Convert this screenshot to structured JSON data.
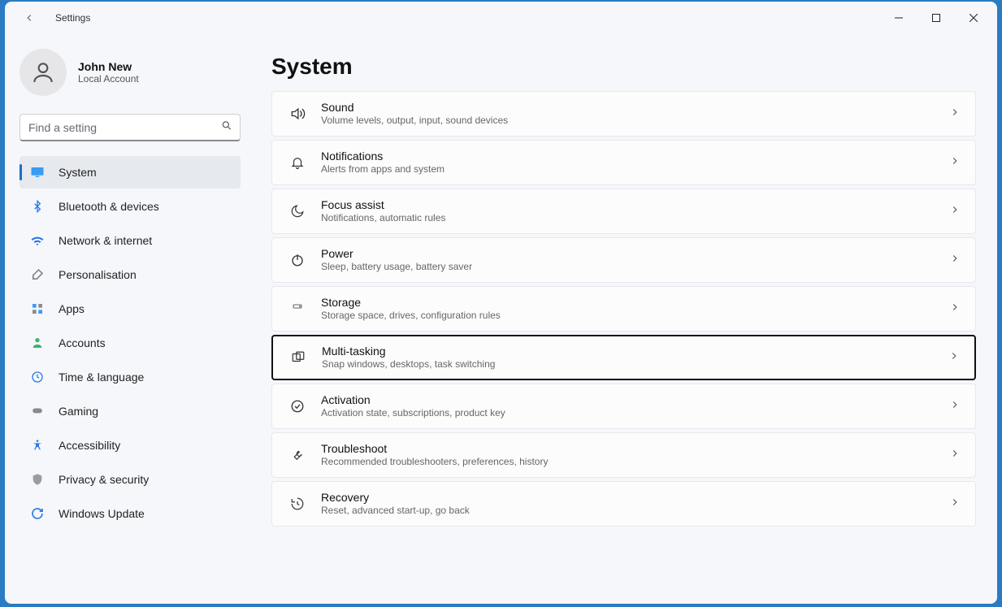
{
  "window": {
    "title": "Settings"
  },
  "user": {
    "name": "John New",
    "subtitle": "Local Account"
  },
  "search": {
    "placeholder": "Find a setting"
  },
  "nav": [
    {
      "id": "system",
      "label": "System",
      "icon": "monitor",
      "active": true
    },
    {
      "id": "bluetooth",
      "label": "Bluetooth & devices",
      "icon": "bluetooth",
      "active": false
    },
    {
      "id": "network",
      "label": "Network & internet",
      "icon": "wifi",
      "active": false
    },
    {
      "id": "personal",
      "label": "Personalisation",
      "icon": "brush",
      "active": false
    },
    {
      "id": "apps",
      "label": "Apps",
      "icon": "grid",
      "active": false
    },
    {
      "id": "accounts",
      "label": "Accounts",
      "icon": "person",
      "active": false
    },
    {
      "id": "time",
      "label": "Time & language",
      "icon": "clock",
      "active": false
    },
    {
      "id": "gaming",
      "label": "Gaming",
      "icon": "gamepad",
      "active": false
    },
    {
      "id": "accessibility",
      "label": "Accessibility",
      "icon": "accessibility",
      "active": false
    },
    {
      "id": "privacy",
      "label": "Privacy & security",
      "icon": "shield",
      "active": false
    },
    {
      "id": "update",
      "label": "Windows Update",
      "icon": "update",
      "active": false
    }
  ],
  "page": {
    "title": "System",
    "items": [
      {
        "id": "sound",
        "title": "Sound",
        "desc": "Volume levels, output, input, sound devices",
        "icon": "sound",
        "focused": false
      },
      {
        "id": "notifications",
        "title": "Notifications",
        "desc": "Alerts from apps and system",
        "icon": "bell",
        "focused": false
      },
      {
        "id": "focus",
        "title": "Focus assist",
        "desc": "Notifications, automatic rules",
        "icon": "moon",
        "focused": false
      },
      {
        "id": "power",
        "title": "Power",
        "desc": "Sleep, battery usage, battery saver",
        "icon": "power",
        "focused": false
      },
      {
        "id": "storage",
        "title": "Storage",
        "desc": "Storage space, drives, configuration rules",
        "icon": "storage",
        "focused": false
      },
      {
        "id": "multitask",
        "title": "Multi-tasking",
        "desc": "Snap windows, desktops, task switching",
        "icon": "multitask",
        "focused": true
      },
      {
        "id": "activation",
        "title": "Activation",
        "desc": "Activation state, subscriptions, product key",
        "icon": "check",
        "focused": false
      },
      {
        "id": "troubleshoot",
        "title": "Troubleshoot",
        "desc": "Recommended troubleshooters, preferences, history",
        "icon": "wrench",
        "focused": false
      },
      {
        "id": "recovery",
        "title": "Recovery",
        "desc": "Reset, advanced start-up, go back",
        "icon": "recovery",
        "focused": false
      }
    ]
  },
  "colors": {
    "accent": "#1f6cc2"
  }
}
